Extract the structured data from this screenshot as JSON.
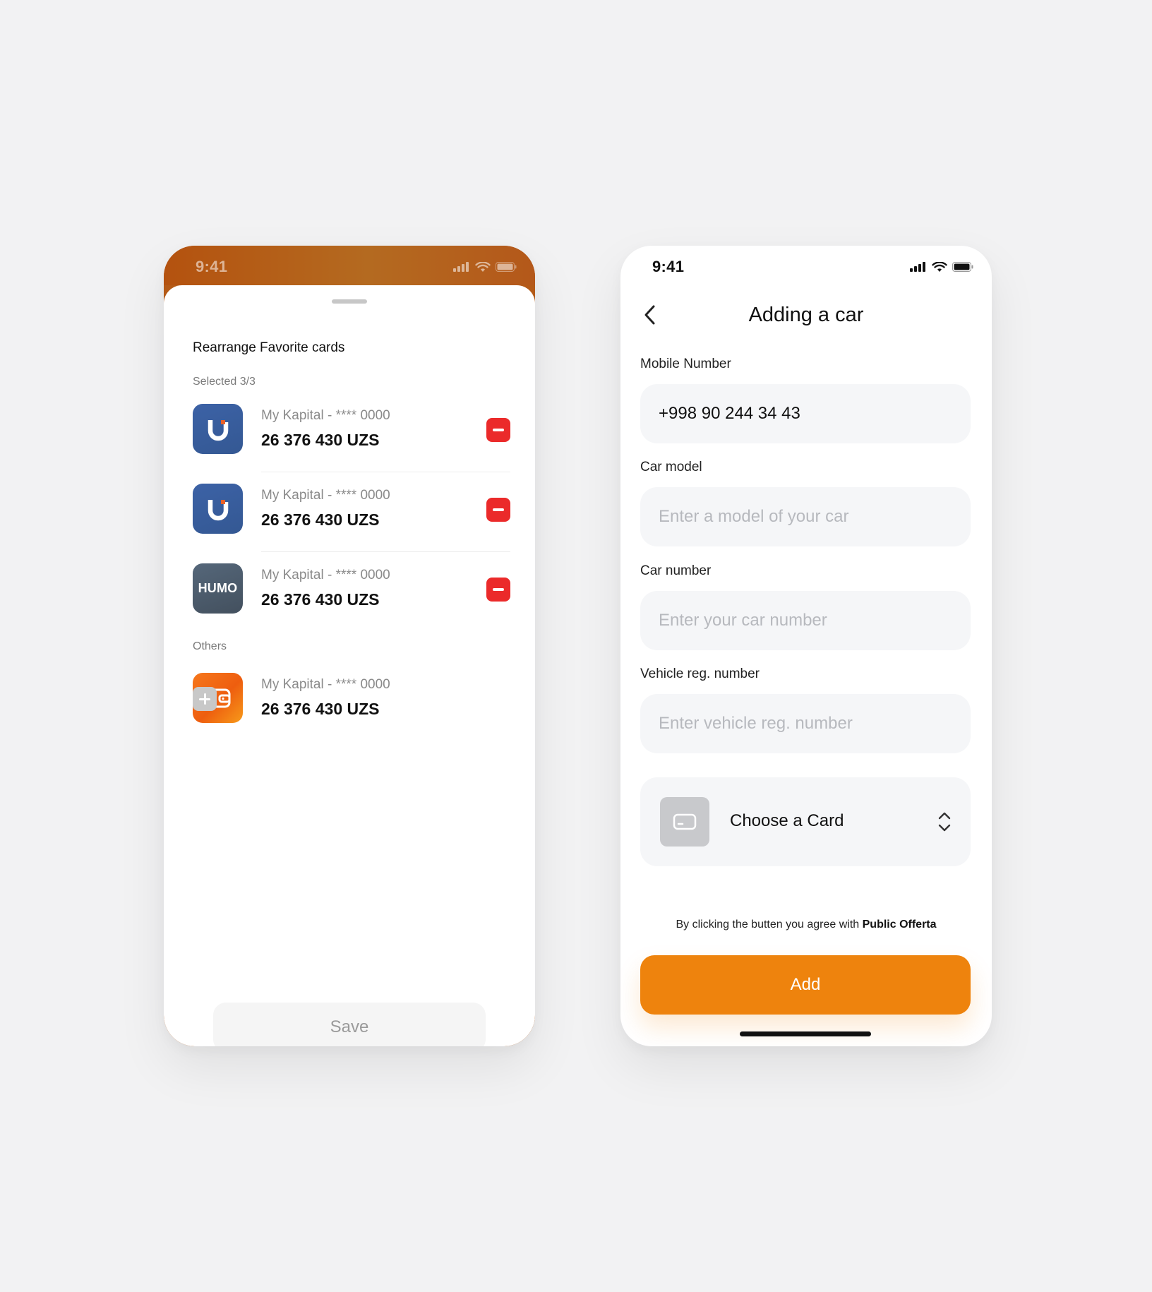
{
  "left_screen": {
    "status_time": "9:41",
    "sheet_title": "Rearrange Favorite cards",
    "selected_label": "Selected 3/3",
    "others_label": "Others",
    "selected_cards": [
      {
        "logo": "uzcard-u-logo",
        "subtitle": "My Kapital - **** 0000",
        "amount": "26 376 430 UZS",
        "action": "remove"
      },
      {
        "logo": "uzcard-u-logo",
        "subtitle": "My Kapital - **** 0000",
        "amount": "26 376 430 UZS",
        "action": "remove"
      },
      {
        "logo": "humo-logo",
        "logo_text": "HUMO",
        "subtitle": "My Kapital - **** 0000",
        "amount": "26 376 430 UZS",
        "action": "remove"
      }
    ],
    "other_cards": [
      {
        "logo": "wallet-icon",
        "subtitle": "My Kapital - **** 0000",
        "amount": "26 376 430 UZS",
        "action": "add"
      }
    ],
    "save_label": "Save"
  },
  "right_screen": {
    "status_time": "9:41",
    "title": "Adding a car",
    "fields": {
      "mobile": {
        "label": "Mobile Number",
        "value": "+998 90 244 34 43"
      },
      "car_model": {
        "label": "Car model",
        "placeholder": "Enter a model of your car"
      },
      "car_number": {
        "label": "Car number",
        "placeholder": "Enter your car number"
      },
      "vehicle_reg": {
        "label": "Vehicle reg. number",
        "placeholder": "Enter vehicle reg. number"
      }
    },
    "choose_card_label": "Choose a Card",
    "offerta_prefix": "By clicking the butten you agree with ",
    "offerta_link": "Public Offerta",
    "add_label": "Add"
  },
  "colors": {
    "accent_orange": "#ee830d",
    "remove_red": "#eb2a2a",
    "uzcard_blue": "#3c62a6",
    "humo_slate": "#4b5a69"
  }
}
